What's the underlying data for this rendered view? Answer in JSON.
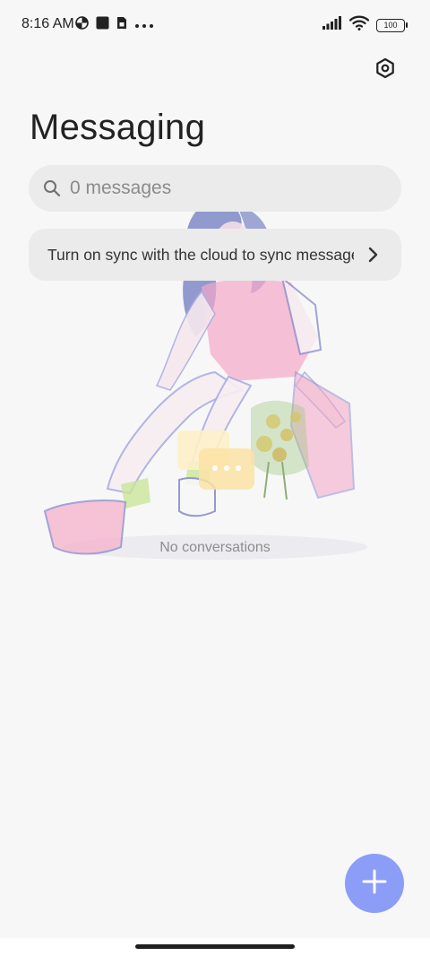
{
  "status_bar": {
    "time": "8:16 AM",
    "left_icons": [
      "data-saver-icon",
      "notification-square-icon",
      "sim-card-icon",
      "more-dots-icon"
    ],
    "right_icons": [
      "signal-icon",
      "wifi-icon",
      "battery-icon"
    ],
    "battery_level": "100"
  },
  "header": {
    "title": "Messaging",
    "settings_icon": "settings-icon"
  },
  "search": {
    "placeholder": "0 messages",
    "icon": "search-icon"
  },
  "sync_banner": {
    "text": "Turn on sync with the cloud to sync messages",
    "icon": "chevron-right-icon"
  },
  "empty_state": {
    "text": "No conversations"
  },
  "fab": {
    "icon": "plus-icon",
    "color": "#8b9df7"
  },
  "colors": {
    "background": "#f7f7f7",
    "surface": "#ebebeb",
    "accent": "#8b9df7"
  }
}
